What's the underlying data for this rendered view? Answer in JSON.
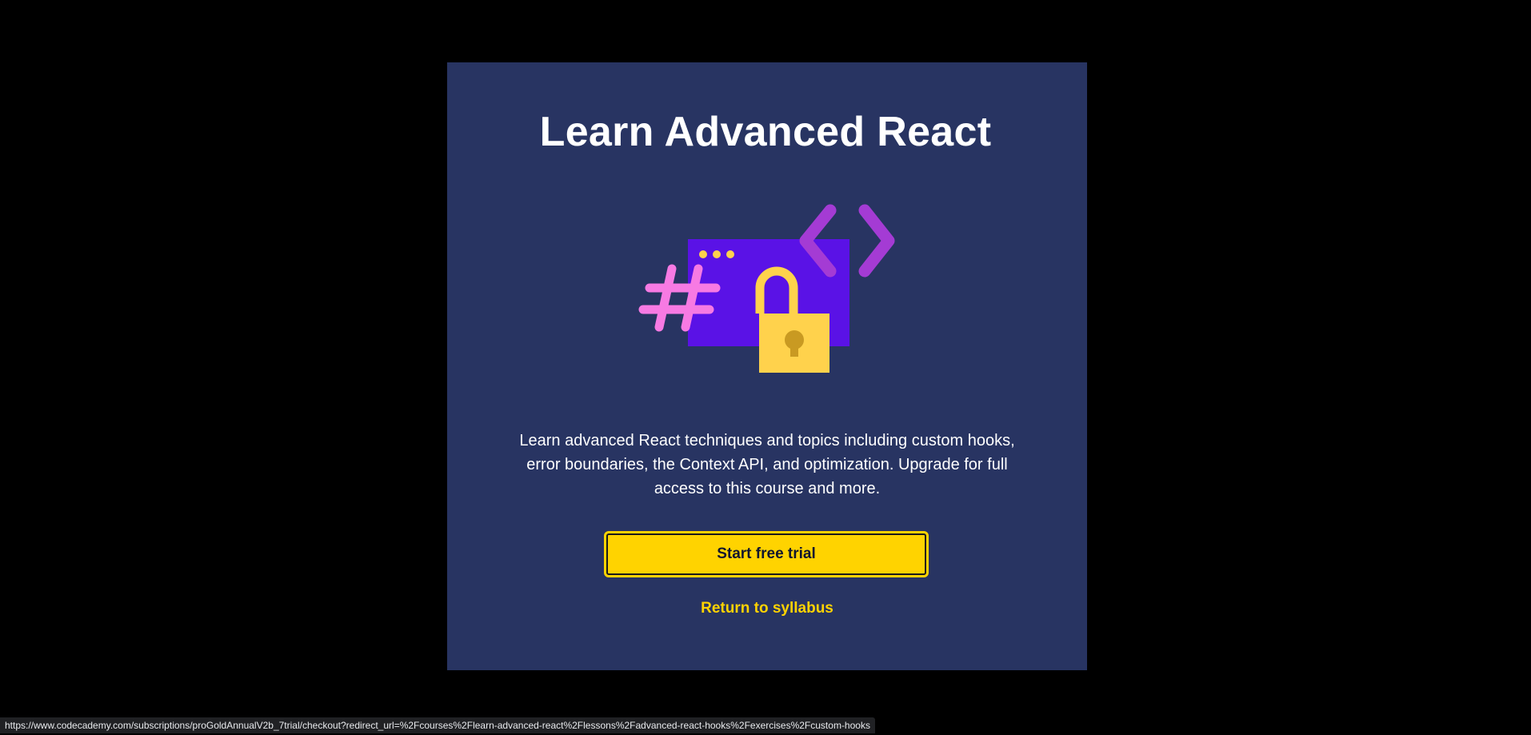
{
  "modal": {
    "title": "Learn Advanced React",
    "illustration_icon": "code-lock-illustration",
    "description": "Learn advanced React techniques and topics including custom hooks, error boundaries, the Context API, and optimization. Upgrade for full access to this course and more.",
    "primary_button_label": "Start free trial",
    "secondary_link_label": "Return to syllabus"
  },
  "status_bar": {
    "url": "https://www.codecademy.com/subscriptions/proGoldAnnualV2b_7trial/checkout?redirect_url=%2Fcourses%2Flearn-advanced-react%2Flessons%2Fadvanced-react-hooks%2Fexercises%2Fcustom-hooks"
  },
  "colors": {
    "backdrop": "#000000",
    "modal_background": "#283462",
    "accent_yellow": "#FFD300",
    "window_purple": "#5A12E6",
    "chevron_purple": "#A43BD4",
    "hash_pink": "#F77AE3",
    "lock_yellow": "#FFD24C"
  }
}
